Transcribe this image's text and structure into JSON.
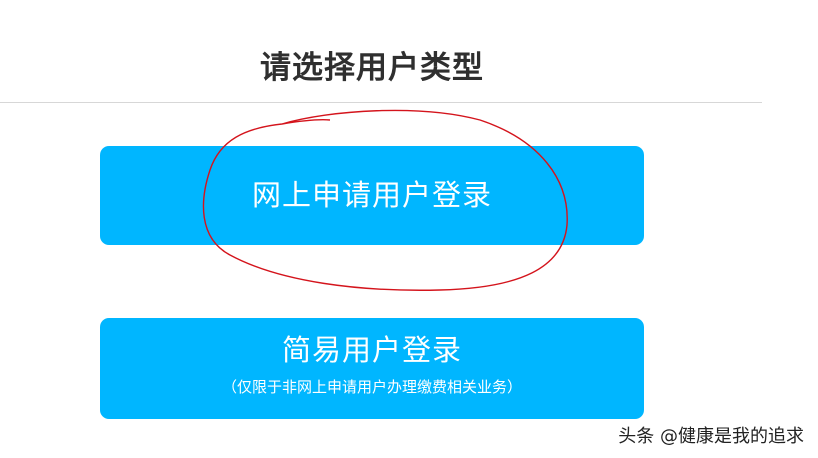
{
  "header": {
    "title": "请选择用户类型"
  },
  "options": {
    "online": {
      "label": "网上申请用户登录"
    },
    "simple": {
      "label": "简易用户登录",
      "note": "（仅限于非网上申请用户办理缴费相关业务）"
    }
  },
  "watermark": {
    "text": "头条 @健康是我的追求"
  },
  "colors": {
    "button_bg": "#00b6ff",
    "button_text": "#ffffff",
    "title_text": "#2f2f2f",
    "annotation": "#d4141c"
  }
}
